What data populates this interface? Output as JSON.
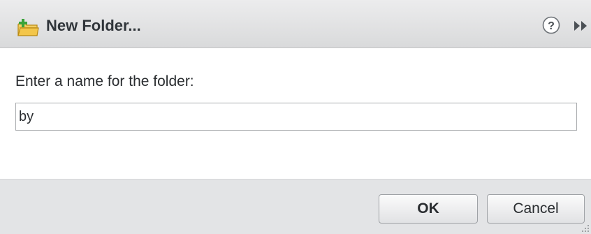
{
  "dialog": {
    "title": "New Folder...",
    "title_icon": "new-folder-icon",
    "help_icon": "help-icon",
    "expand_icon": "expand-icon"
  },
  "form": {
    "prompt": "Enter a name for the folder:",
    "folder_name_value": "by"
  },
  "footer": {
    "ok_label": "OK",
    "cancel_label": "Cancel"
  },
  "colors": {
    "titlebar": "#d9dadb",
    "footer": "#e3e4e6",
    "folder_icon": "#f3c64a",
    "plus_icon": "#3aa33a",
    "help_icon": "#555a5f"
  }
}
